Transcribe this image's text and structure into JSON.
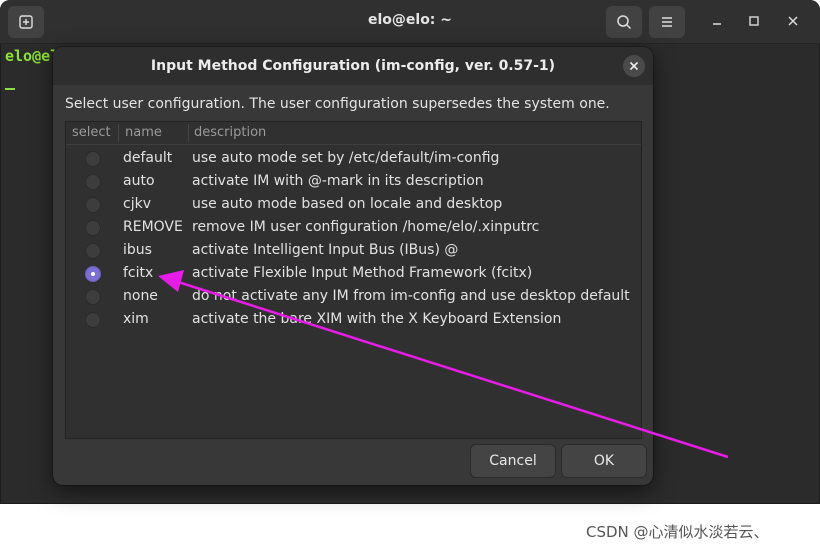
{
  "terminal": {
    "title": "elo@elo: ~",
    "prompt": "elo@elo",
    "new_tab_icon": "new-tab-icon",
    "search_icon": "search-icon",
    "menu_icon": "hamburger-menu-icon"
  },
  "dialog": {
    "title": "Input Method Configuration (im-config, ver. 0.57-1)",
    "instruction": "Select user configuration. The user configuration supersedes the system one.",
    "columns": {
      "select": "select",
      "name": "name",
      "description": "description"
    },
    "rows": [
      {
        "name": "default",
        "description": "use auto mode set by /etc/default/im-config",
        "selected": false
      },
      {
        "name": "auto",
        "description": "activate IM with @-mark in its description",
        "selected": false
      },
      {
        "name": "cjkv",
        "description": "use auto mode based on locale and desktop",
        "selected": false
      },
      {
        "name": "REMOVE",
        "description": "remove IM user configuration /home/elo/.xinputrc",
        "selected": false
      },
      {
        "name": "ibus",
        "description": "activate Intelligent Input Bus (IBus) @",
        "selected": false
      },
      {
        "name": "fcitx",
        "description": "activate Flexible Input Method Framework (fcitx)",
        "selected": true
      },
      {
        "name": "none",
        "description": "do not activate any IM from im-config and use desktop default",
        "selected": false
      },
      {
        "name": "xim",
        "description": "activate the bare XIM with the X Keyboard Extension",
        "selected": false
      }
    ],
    "cancel_label": "Cancel",
    "ok_label": "OK",
    "selected_color": "#7b6fd4"
  },
  "annotation": {
    "arrow_color": "#e81ce8"
  },
  "watermark": "CSDN @心清似水淡若云、"
}
